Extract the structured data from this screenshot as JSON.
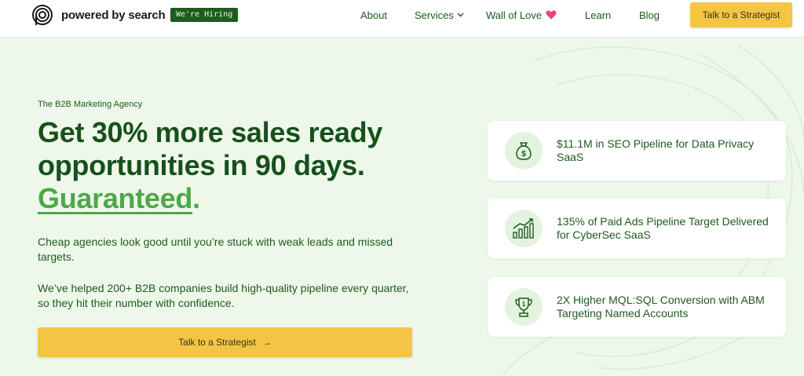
{
  "header": {
    "logo_text": "powered by search",
    "hiring_badge": "We're Hiring",
    "nav": {
      "about": "About",
      "services": "Services",
      "wall_of_love": "Wall of Love",
      "learn": "Learn",
      "blog": "Blog"
    },
    "cta": "Talk to a Strategist"
  },
  "hero": {
    "eyebrow": "The B2B Marketing Agency",
    "headline_line1": "Get 30% more sales ready",
    "headline_line2": "opportunities in 90 days.",
    "headline_accent": "Guaranteed",
    "headline_dot": ".",
    "paragraph1": "Cheap agencies look good until you’re stuck with weak leads and missed targets.",
    "paragraph2": "We’ve helped 200+ B2B companies build high-quality pipeline every quarter, so they hit their number with confidence.",
    "cta_label": "Talk to a Strategist",
    "cta_arrow": "→"
  },
  "stats": [
    {
      "icon": "money-bag-icon",
      "text": "$11.1M in SEO Pipeline for Data Privacy SaaS"
    },
    {
      "icon": "bar-chart-growth-icon",
      "text": "135% of Paid Ads Pipeline Target Delivered for CyberSec SaaS"
    },
    {
      "icon": "trophy-icon",
      "text": "2X Higher MQL:SQL Conversion with ABM Targeting Named Accounts"
    }
  ],
  "colors": {
    "brand_green": "#17501a",
    "accent_green": "#4da84a",
    "cta_yellow": "#f4c545",
    "page_background": "#edf8ea",
    "heart": "#e8457a"
  }
}
